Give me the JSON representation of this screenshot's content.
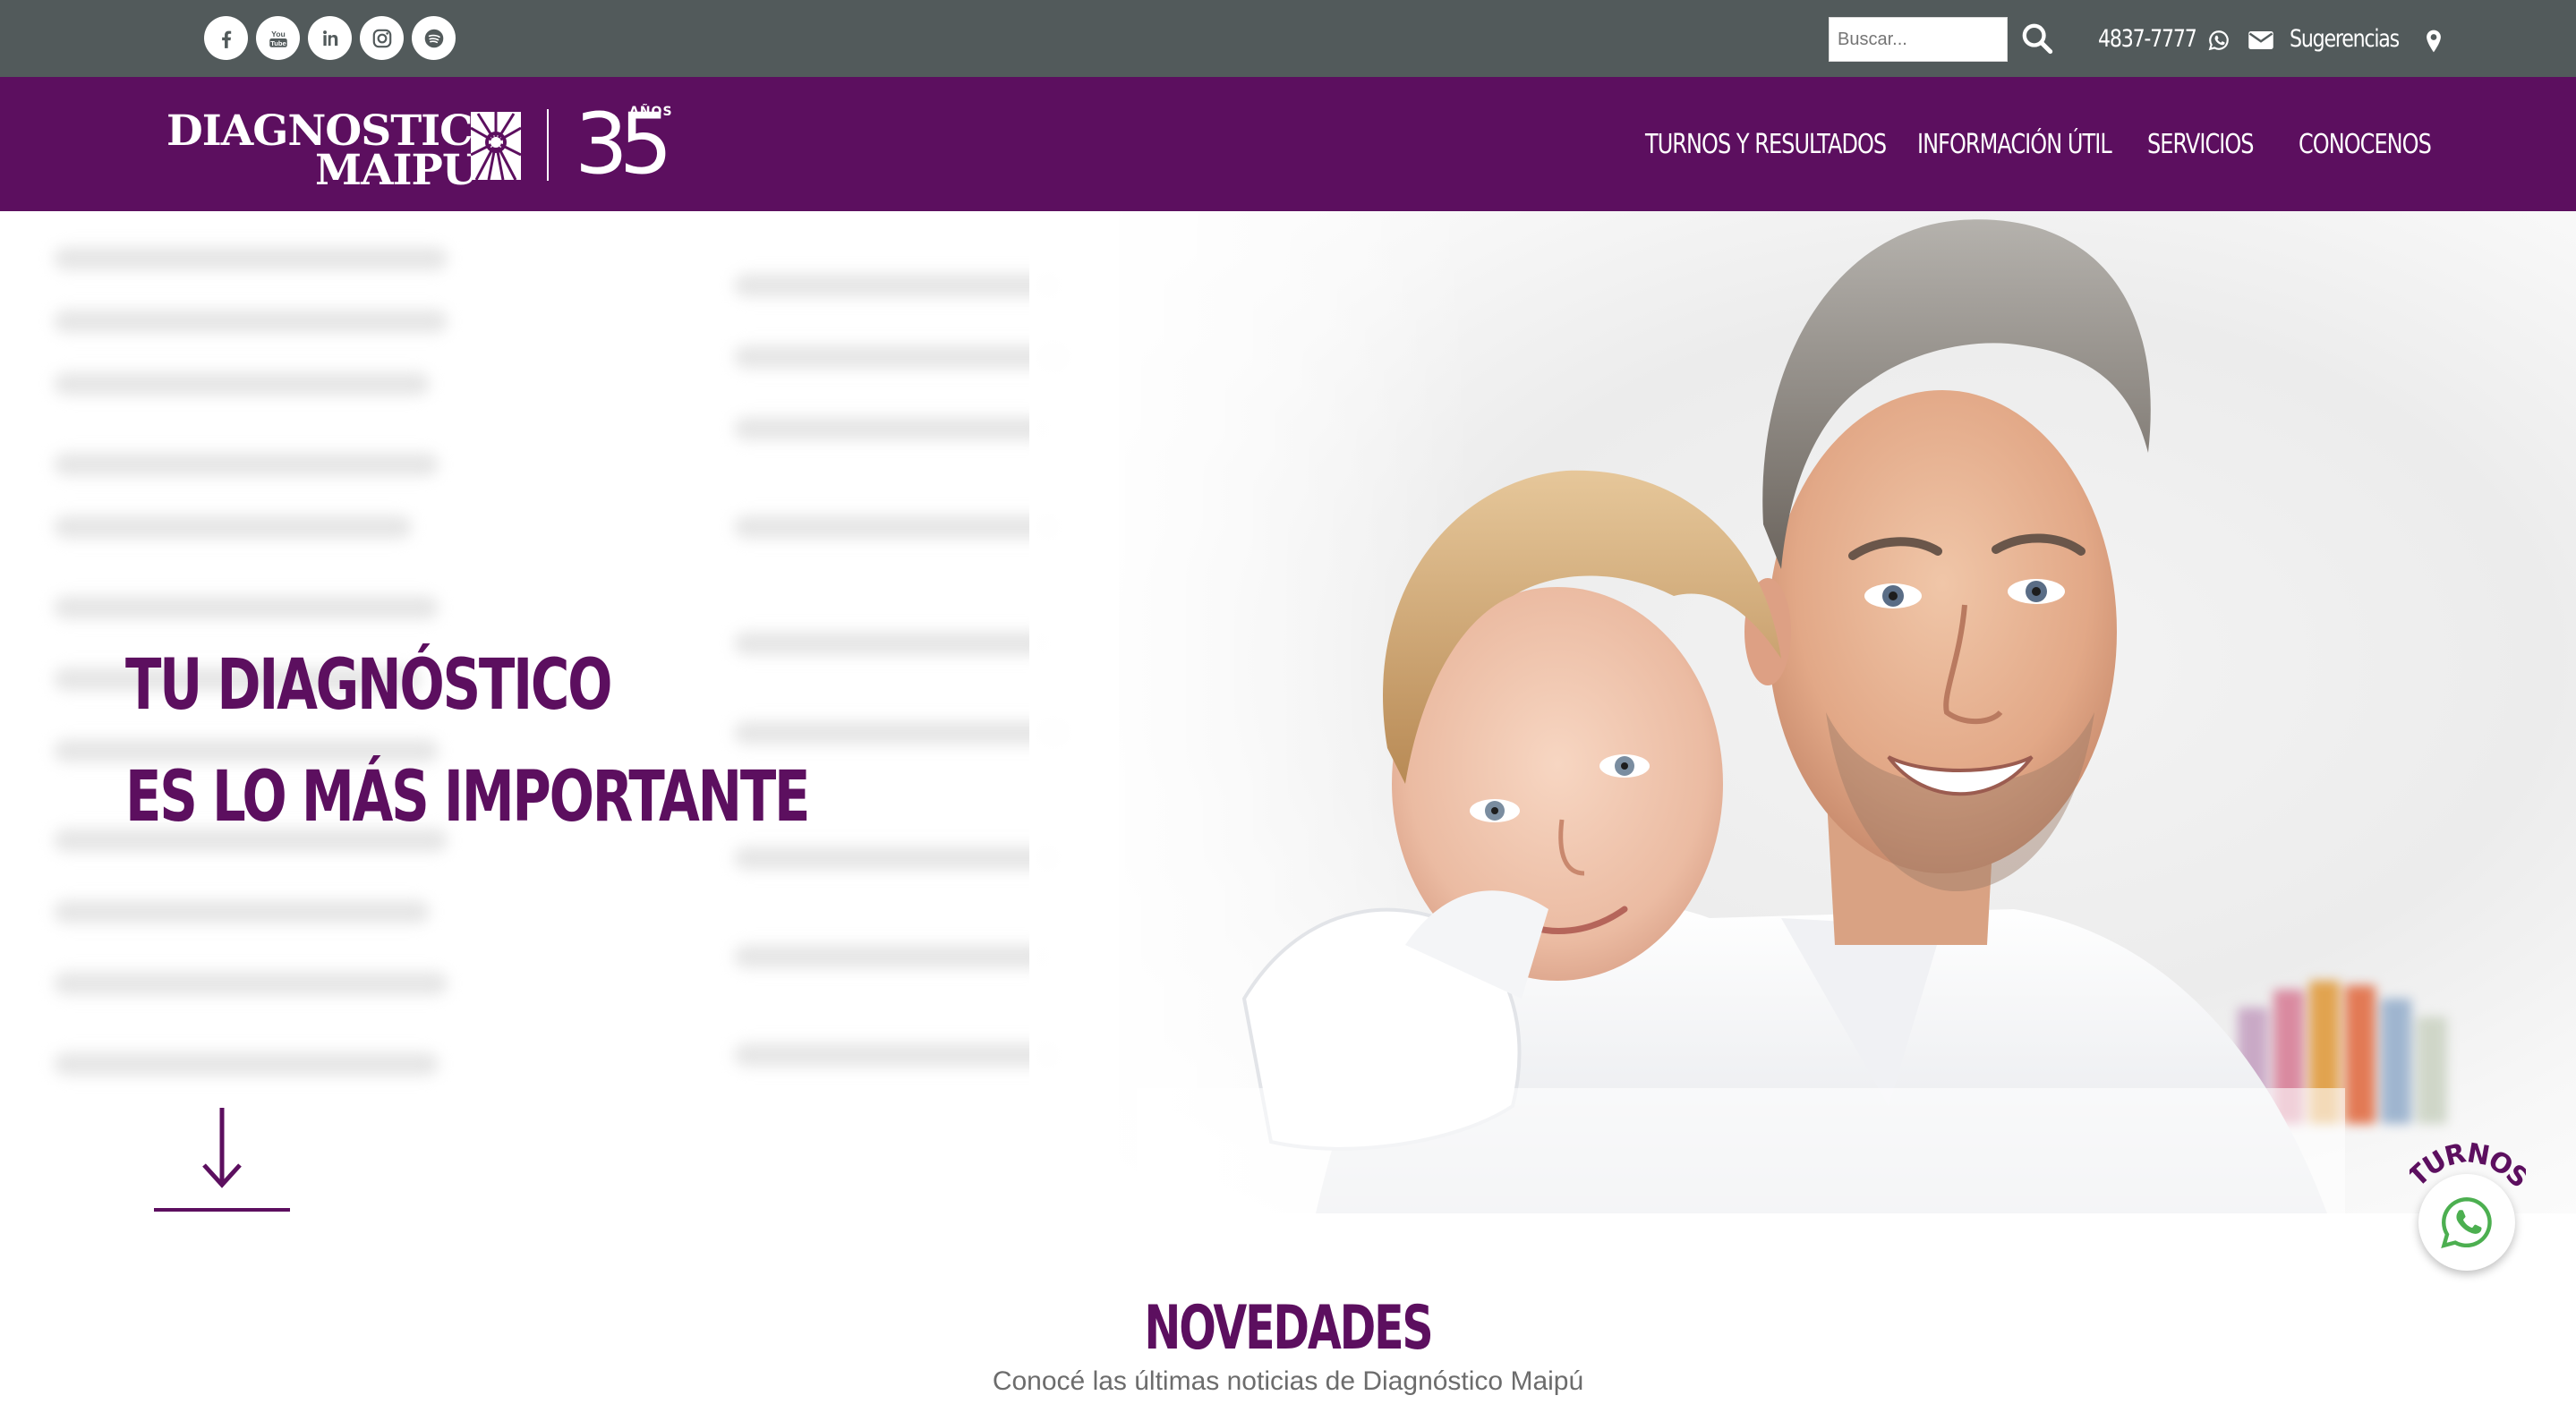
{
  "topbar": {
    "social": [
      {
        "name": "facebook",
        "icon": "facebook-icon"
      },
      {
        "name": "youtube",
        "icon": "youtube-icon"
      },
      {
        "name": "linkedin",
        "icon": "linkedin-icon"
      },
      {
        "name": "instagram",
        "icon": "instagram-icon"
      },
      {
        "name": "spotify",
        "icon": "spotify-icon"
      }
    ],
    "search_placeholder": "Buscar...",
    "phone": "4837-7777",
    "suggestions": "Sugerencias"
  },
  "header": {
    "logo": {
      "line1": "DIAGNOSTICO",
      "line2": "MAIPU",
      "anniversary_number": "35",
      "anniversary_label": "AÑOS"
    },
    "nav": [
      {
        "label": "TURNOS Y RESULTADOS"
      },
      {
        "label": "INFORMACIÓN ÚTIL"
      },
      {
        "label": "SERVICIOS"
      },
      {
        "label": "CONOCENOS"
      }
    ]
  },
  "hero": {
    "title_line1": "TU DIAGNÓSTICO",
    "title_line2": "ES LO MÁS IMPORTANTE"
  },
  "whatsapp_float": {
    "label": "TURNOS"
  },
  "news": {
    "title": "NOVEDADES",
    "subtitle": "Conocé las últimas noticias de Diagnóstico Maipú"
  },
  "colors": {
    "brand_purple": "#5c0f5f",
    "topbar_gray": "#525a5b",
    "whatsapp_green": "#4caf50",
    "subtitle_gray": "#6c6c6c"
  }
}
